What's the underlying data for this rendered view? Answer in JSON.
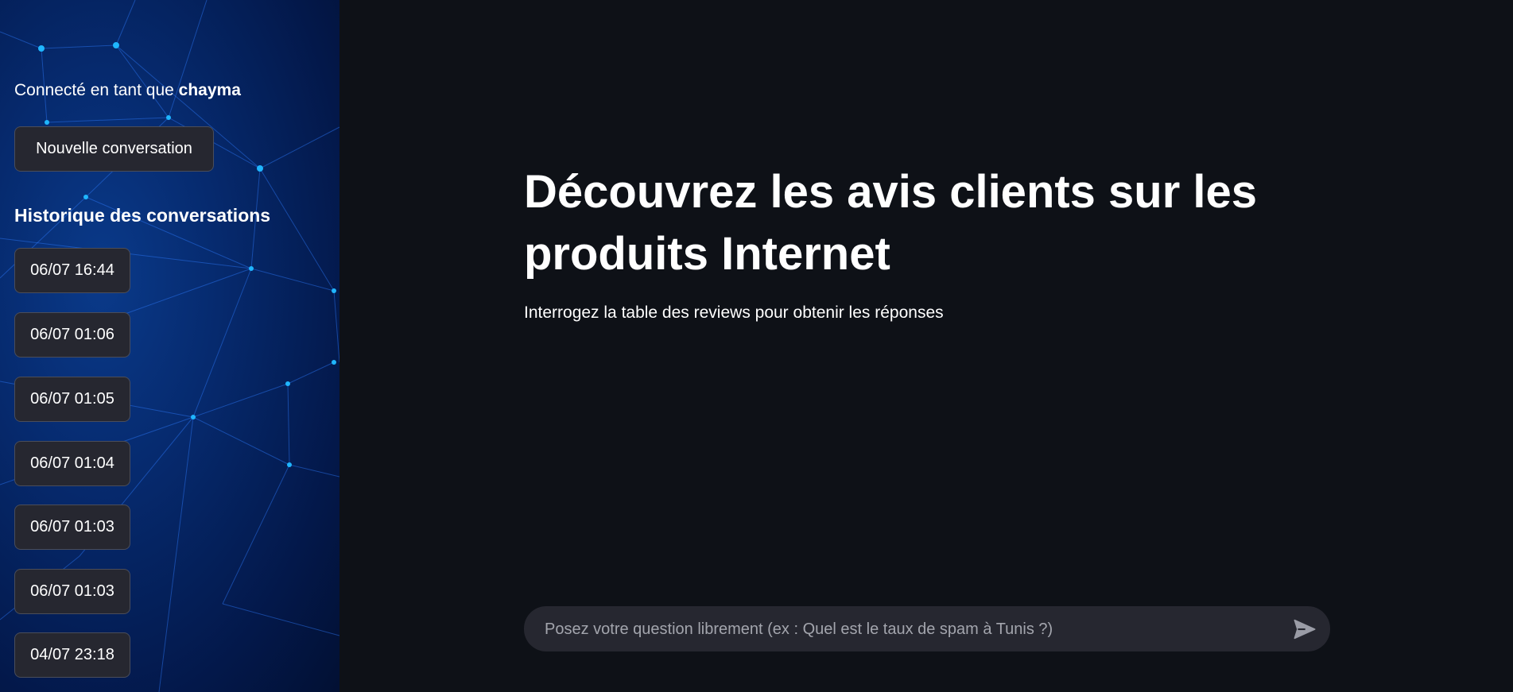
{
  "sidebar": {
    "user_prefix": "Connecté en tant que",
    "username": "chayma",
    "new_conversation_label": "Nouvelle conversation",
    "history_title": "Historique des conversations",
    "history": [
      {
        "label": "06/07 16:44"
      },
      {
        "label": "06/07 01:06"
      },
      {
        "label": "06/07 01:05"
      },
      {
        "label": "06/07 01:04"
      },
      {
        "label": "06/07 01:03"
      },
      {
        "label": "06/07 01:03"
      },
      {
        "label": "04/07 23:18"
      }
    ]
  },
  "main": {
    "headline": "Découvrez les avis clients sur les produits Internet",
    "subtitle": "Interrogez la table des reviews pour obtenir les réponses"
  },
  "chat": {
    "placeholder": "Posez votre question librement (ex : Quel est le taux de spam à Tunis ?)",
    "send_icon": "send-icon"
  },
  "colors": {
    "main_bg": "#0e1117",
    "sidebar_bg": "#03184a",
    "button_bg": "#262730",
    "network_node": "#1fb6ff"
  }
}
